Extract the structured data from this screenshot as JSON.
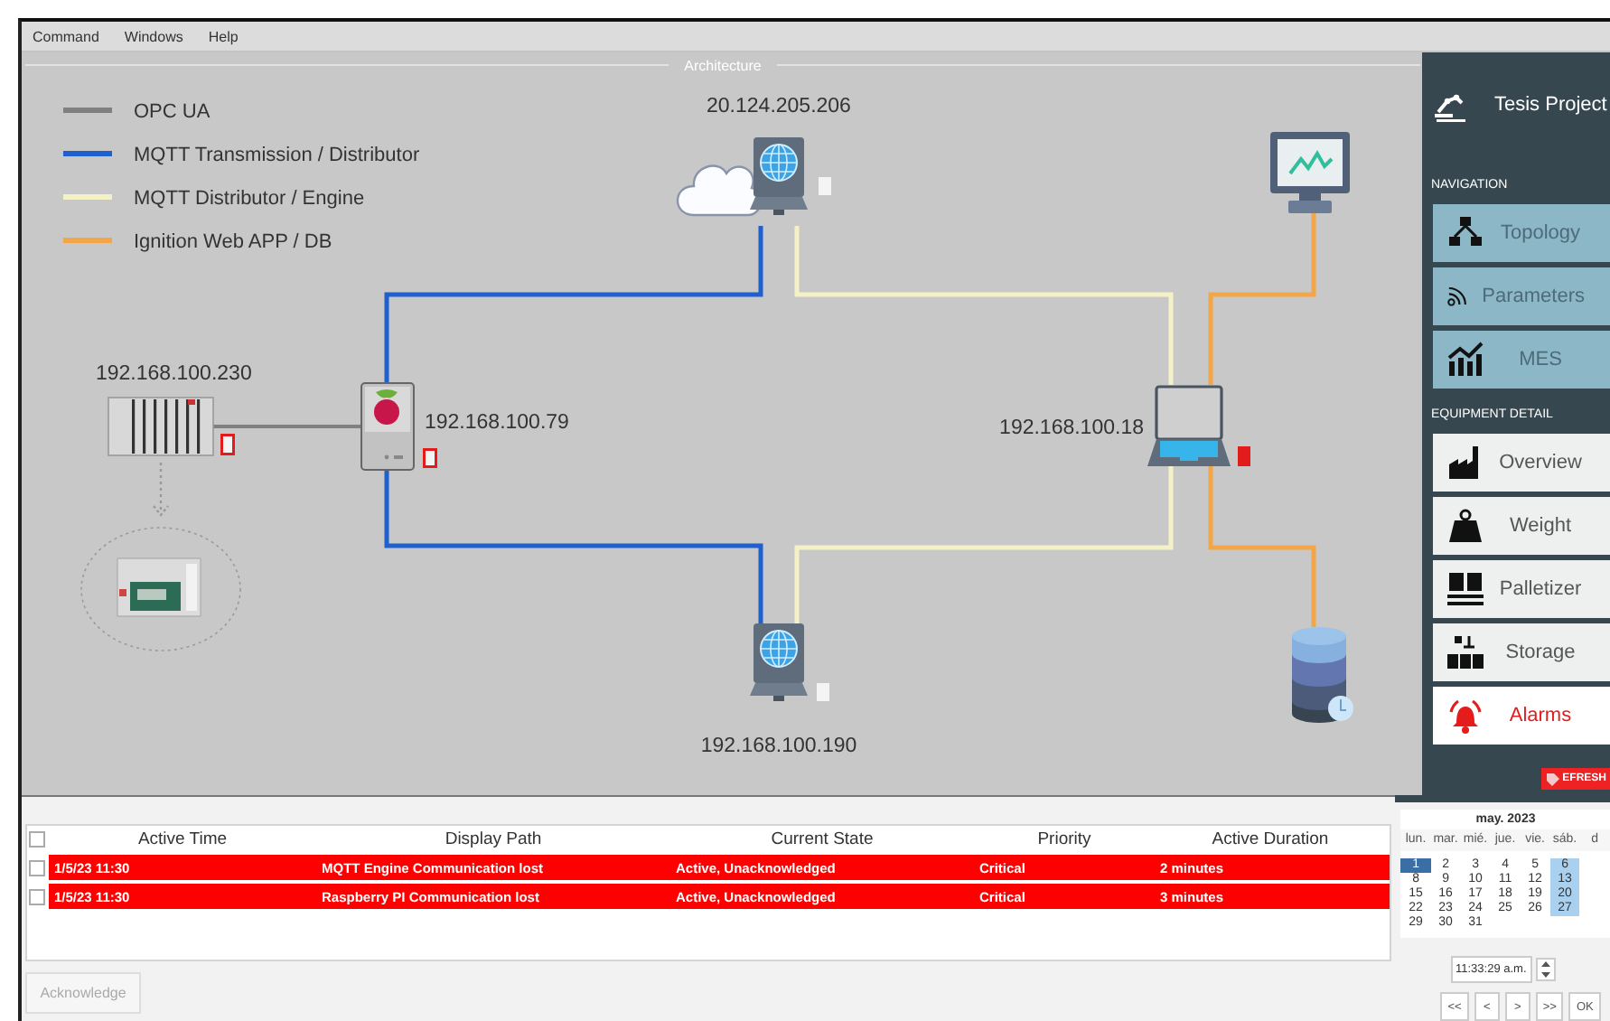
{
  "menu": [
    {
      "label": "Command"
    },
    {
      "label": "Windows"
    },
    {
      "label": "Help"
    }
  ],
  "architecture": {
    "title": "Architecture",
    "legend": [
      {
        "label": "OPC UA",
        "color": "#808080"
      },
      {
        "label": "MQTT Transmission / Distributor",
        "color": "#1f5fce"
      },
      {
        "label": "MQTT Distributor / Engine",
        "color": "#f4f1c6"
      },
      {
        "label": "Ignition Web APP / DB",
        "color": "#f3a648"
      }
    ],
    "nodes": [
      {
        "kind": "cloud-server",
        "label": "20.124.205.206",
        "alarm": false,
        "active": false
      },
      {
        "kind": "plc",
        "label": "192.168.100.230",
        "alarm": true,
        "active": false
      },
      {
        "kind": "raspberry",
        "label": "192.168.100.79",
        "alarm": true,
        "active": false
      },
      {
        "kind": "laptop",
        "label": "192.168.100.18",
        "alarm": true,
        "active": true
      },
      {
        "kind": "monitor"
      },
      {
        "kind": "database"
      },
      {
        "kind": "server",
        "label": "192.168.100.190",
        "alarm": false,
        "active": false
      },
      {
        "kind": "machine"
      }
    ]
  },
  "sidebar": {
    "title": "Tesis Project",
    "sections": [
      {
        "kind": "navigation",
        "heading": "NAVIGATION",
        "items": [
          {
            "label": "Topology",
            "alert": false
          },
          {
            "label": "Parameters",
            "alert": false
          },
          {
            "label": "MES",
            "alert": false
          }
        ]
      },
      {
        "kind": "equipment",
        "heading": "EQUIPMENT DETAIL",
        "items": [
          {
            "label": "Overview",
            "alert": false
          },
          {
            "label": "Weight",
            "alert": false
          },
          {
            "label": "Palletizer",
            "alert": false
          },
          {
            "label": "Storage",
            "alert": false
          },
          {
            "label": "Alarms",
            "alert": true
          }
        ]
      }
    ],
    "refresh": "EFRESH"
  },
  "alarm_table": {
    "all_checked": false,
    "columns": [
      "Active Time",
      "Display Path",
      "Current State",
      "Priority",
      "Active Duration"
    ],
    "rows": [
      {
        "checked": false,
        "color": "#ff0000",
        "cells": [
          "1/5/23 11:30",
          "MQTT Engine Communication lost",
          "Active, Unacknowledged",
          "Critical",
          "2 minutes"
        ]
      },
      {
        "checked": false,
        "color": "#ff0000",
        "cells": [
          "1/5/23 11:30",
          "Raspberry PI Communication lost",
          "Active, Unacknowledged",
          "Critical",
          "3 minutes"
        ]
      }
    ],
    "acknowledge": {
      "label": "Acknowledge",
      "disabled": true
    }
  },
  "calendar": {
    "title": "may. 2023",
    "weekdays": [
      "lun.",
      "mar.",
      "mié.",
      "jue.",
      "vie.",
      "sáb.",
      "d"
    ],
    "weeks": [
      [
        {
          "text": "1",
          "selected": true,
          "highlighted": false
        },
        {
          "text": "2",
          "selected": false,
          "highlighted": false
        },
        {
          "text": "3",
          "selected": false,
          "highlighted": false
        },
        {
          "text": "4",
          "selected": false,
          "highlighted": false
        },
        {
          "text": "5",
          "selected": false,
          "highlighted": false
        },
        {
          "text": "6",
          "selected": false,
          "highlighted": true
        }
      ],
      [
        {
          "text": "8",
          "selected": false,
          "highlighted": false
        },
        {
          "text": "9",
          "selected": false,
          "highlighted": false
        },
        {
          "text": "10",
          "selected": false,
          "highlighted": false
        },
        {
          "text": "11",
          "selected": false,
          "highlighted": false
        },
        {
          "text": "12",
          "selected": false,
          "highlighted": false
        },
        {
          "text": "13",
          "selected": false,
          "highlighted": true
        }
      ],
      [
        {
          "text": "15",
          "selected": false,
          "highlighted": false
        },
        {
          "text": "16",
          "selected": false,
          "highlighted": false
        },
        {
          "text": "17",
          "selected": false,
          "highlighted": false
        },
        {
          "text": "18",
          "selected": false,
          "highlighted": false
        },
        {
          "text": "19",
          "selected": false,
          "highlighted": false
        },
        {
          "text": "20",
          "selected": false,
          "highlighted": true
        }
      ],
      [
        {
          "text": "22",
          "selected": false,
          "highlighted": false
        },
        {
          "text": "23",
          "selected": false,
          "highlighted": false
        },
        {
          "text": "24",
          "selected": false,
          "highlighted": false
        },
        {
          "text": "25",
          "selected": false,
          "highlighted": false
        },
        {
          "text": "26",
          "selected": false,
          "highlighted": false
        },
        {
          "text": "27",
          "selected": false,
          "highlighted": true
        }
      ],
      [
        {
          "text": "29",
          "selected": false,
          "highlighted": false
        },
        {
          "text": "30",
          "selected": false,
          "highlighted": false
        },
        {
          "text": "31",
          "selected": false,
          "highlighted": false
        }
      ]
    ],
    "time": "11:33:29 a.m.",
    "buttons": [
      "<<",
      "<",
      ">",
      ">>",
      "OK"
    ]
  }
}
